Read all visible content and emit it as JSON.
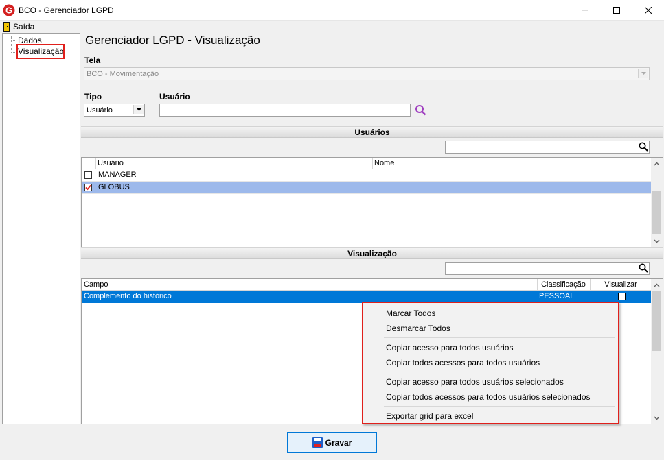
{
  "window": {
    "title": "BCO - Gerenciador LGPD"
  },
  "menu": {
    "exit_label": "Saída"
  },
  "tree": {
    "items": [
      "Dados",
      "Visualização"
    ]
  },
  "page": {
    "title": "Gerenciador LGPD - Visualização"
  },
  "form": {
    "tela_label": "Tela",
    "tela_value": "BCO - Movimentação",
    "tipo_label": "Tipo",
    "tipo_value": "Usuário",
    "usuario_label": "Usuário",
    "usuario_value": ""
  },
  "users_section": {
    "title": "Usuários",
    "search_value": "",
    "columns": [
      "Usuário",
      "Nome"
    ],
    "rows": [
      {
        "usuario": "MANAGER",
        "nome": "",
        "checked": false
      },
      {
        "usuario": "GLOBUS",
        "nome": "",
        "checked": true
      }
    ]
  },
  "view_section": {
    "title": "Visualização",
    "search_value": "",
    "columns": [
      "Campo",
      "Classificação",
      "Visualizar"
    ],
    "rows": [
      {
        "campo": "Complemento do histórico",
        "classificacao": "PESSOAL",
        "visualizar": false
      }
    ]
  },
  "context_menu": {
    "items": [
      "Marcar Todos",
      "Desmarcar Todos",
      "Copiar acesso para todos usuários",
      "Copiar todos acessos para todos usuários",
      "Copiar acesso para todos usuários selecionados",
      "Copiar todos acessos para todos usuários selecionados",
      "Exportar grid para excel"
    ]
  },
  "footer": {
    "save_label": "Gravar"
  },
  "colors": {
    "selected_row": "#9db9eb",
    "highlight_row": "#0078d7",
    "annotation_red": "#e0201c",
    "search_icon_purple": "#a040c0"
  }
}
